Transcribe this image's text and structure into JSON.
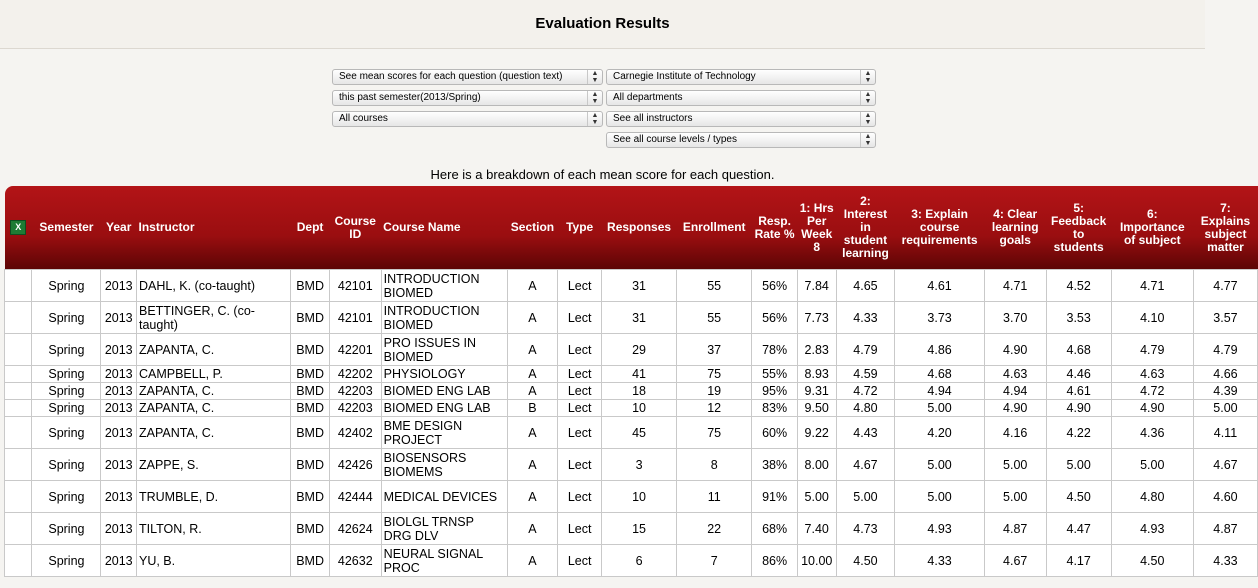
{
  "page": {
    "title": "Evaluation Results",
    "subtitle": "Here is a breakdown of each mean score for each question."
  },
  "filters": {
    "view": "See mean scores for each question (question text)",
    "college": "Carnegie Institute of Technology",
    "semester": "this past semester(2013/Spring)",
    "department": "All departments",
    "courses": "All courses",
    "instructors": "See all instructors",
    "levels": "See all course levels / types"
  },
  "table": {
    "export_icon": "excel-icon",
    "headers": {
      "semester": "Semester",
      "year": "Year",
      "instructor": "Instructor",
      "dept": "Dept",
      "course_id": "Course ID",
      "course_name": "Course Name",
      "section": "Section",
      "type": "Type",
      "responses": "Responses",
      "enrollment": "Enrollment",
      "resp_rate": "Resp. Rate %",
      "q1": "1: Hrs Per Week 8",
      "q2": "2: Interest in student learning",
      "q3": "3: Explain course requirements",
      "q4": "4: Clear learning goals",
      "q5": "5: Feedback to students",
      "q6": "6: Importance of subject",
      "q7": "7: Explains subject matter"
    },
    "rows": [
      [
        "Spring",
        "2013",
        "DAHL, K. (co-taught)",
        "BMD",
        "42101",
        "INTRODUCTION BIOMED",
        "A",
        "Lect",
        "31",
        "55",
        "56%",
        "7.84",
        "4.65",
        "4.61",
        "4.71",
        "4.52",
        "4.71",
        "4.77"
      ],
      [
        "Spring",
        "2013",
        "BETTINGER, C. (co-taught)",
        "BMD",
        "42101",
        "INTRODUCTION BIOMED",
        "A",
        "Lect",
        "31",
        "55",
        "56%",
        "7.73",
        "4.33",
        "3.73",
        "3.70",
        "3.53",
        "4.10",
        "3.57"
      ],
      [
        "Spring",
        "2013",
        "ZAPANTA, C.",
        "BMD",
        "42201",
        "PRO ISSUES IN BIOMED",
        "A",
        "Lect",
        "29",
        "37",
        "78%",
        "2.83",
        "4.79",
        "4.86",
        "4.90",
        "4.68",
        "4.79",
        "4.79"
      ],
      [
        "Spring",
        "2013",
        "CAMPBELL, P.",
        "BMD",
        "42202",
        "PHYSIOLOGY",
        "A",
        "Lect",
        "41",
        "75",
        "55%",
        "8.93",
        "4.59",
        "4.68",
        "4.63",
        "4.46",
        "4.63",
        "4.66"
      ],
      [
        "Spring",
        "2013",
        "ZAPANTA, C.",
        "BMD",
        "42203",
        "BIOMED ENG LAB",
        "A",
        "Lect",
        "18",
        "19",
        "95%",
        "9.31",
        "4.72",
        "4.94",
        "4.94",
        "4.61",
        "4.72",
        "4.39"
      ],
      [
        "Spring",
        "2013",
        "ZAPANTA, C.",
        "BMD",
        "42203",
        "BIOMED ENG LAB",
        "B",
        "Lect",
        "10",
        "12",
        "83%",
        "9.50",
        "4.80",
        "5.00",
        "4.90",
        "4.90",
        "4.90",
        "5.00"
      ],
      [
        "Spring",
        "2013",
        "ZAPANTA, C.",
        "BMD",
        "42402",
        "BME DESIGN PROJECT",
        "A",
        "Lect",
        "45",
        "75",
        "60%",
        "9.22",
        "4.43",
        "4.20",
        "4.16",
        "4.22",
        "4.36",
        "4.11"
      ],
      [
        "Spring",
        "2013",
        "ZAPPE, S.",
        "BMD",
        "42426",
        "BIOSENSORS BIOMEMS",
        "A",
        "Lect",
        "3",
        "8",
        "38%",
        "8.00",
        "4.67",
        "5.00",
        "5.00",
        "5.00",
        "5.00",
        "4.67"
      ],
      [
        "Spring",
        "2013",
        "TRUMBLE, D.",
        "BMD",
        "42444",
        "MEDICAL DEVICES",
        "A",
        "Lect",
        "10",
        "11",
        "91%",
        "5.00",
        "5.00",
        "5.00",
        "5.00",
        "4.50",
        "4.80",
        "4.60"
      ],
      [
        "Spring",
        "2013",
        "TILTON, R.",
        "BMD",
        "42624",
        "BIOLGL TRNSP DRG DLV",
        "A",
        "Lect",
        "15",
        "22",
        "68%",
        "7.40",
        "4.73",
        "4.93",
        "4.87",
        "4.47",
        "4.93",
        "4.87"
      ],
      [
        "Spring",
        "2013",
        "YU, B.",
        "BMD",
        "42632",
        "NEURAL SIGNAL PROC",
        "A",
        "Lect",
        "6",
        "7",
        "86%",
        "10.00",
        "4.50",
        "4.33",
        "4.67",
        "4.17",
        "4.50",
        "4.33"
      ]
    ]
  }
}
